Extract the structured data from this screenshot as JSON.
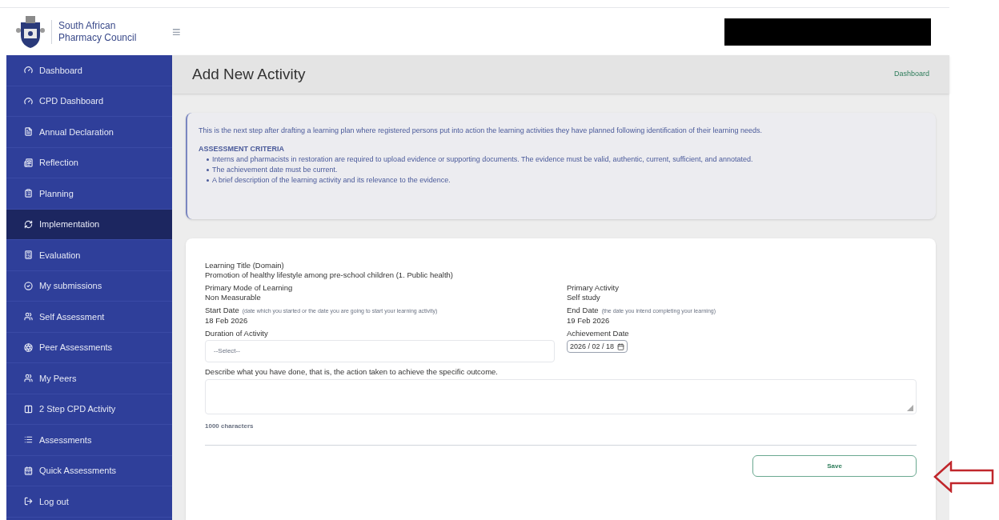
{
  "brand": {
    "line1": "South African",
    "line2": "Pharmacy Council"
  },
  "menu_icon": "≡",
  "sidebar": {
    "items": [
      {
        "label": "Dashboard",
        "selected": false
      },
      {
        "label": "CPD Dashboard",
        "selected": false
      },
      {
        "label": "Annual Declaration",
        "selected": false
      },
      {
        "label": "Reflection",
        "selected": false
      },
      {
        "label": "Planning",
        "selected": false
      },
      {
        "label": "Implementation",
        "selected": true
      },
      {
        "label": "Evaluation",
        "selected": false
      },
      {
        "label": "My submissions",
        "selected": false
      },
      {
        "label": "Self Assessment",
        "selected": false
      },
      {
        "label": "Peer Assessments",
        "selected": false
      },
      {
        "label": "My Peers",
        "selected": false
      },
      {
        "label": "2 Step CPD Activity",
        "selected": false
      },
      {
        "label": "Assessments",
        "selected": false
      },
      {
        "label": "Quick Assessments",
        "selected": false
      },
      {
        "label": "Log out",
        "selected": false
      }
    ]
  },
  "page": {
    "title": "Add New Activity",
    "breadcrumb": "Dashboard"
  },
  "info": {
    "intro": "This is the next step after drafting a learning plan where registered persons put into action the learning activities they have planned following identification of their learning needs.",
    "heading": "ASSESSMENT CRITERIA",
    "bullets": [
      "Interns and pharmacists in restoration are required to upload evidence or supporting documents. The evidence must be valid, authentic, current, sufficient, and annotated.",
      "The achievement date must be current.",
      "A brief description of the learning activity and its relevance to the evidence."
    ]
  },
  "form": {
    "learning_title": {
      "label": "Learning Title (Domain)",
      "value": "Promotion of healthy lifestyle among pre-school children (1. Public health)"
    },
    "primary_mode": {
      "label": "Primary Mode of Learning",
      "value": "Non Measurable"
    },
    "primary_activity": {
      "label": "Primary Activity",
      "value": "Self study"
    },
    "start_date": {
      "label": "Start Date",
      "note": "(date which you started or the date you are going to start your learning activity)",
      "value": "18 Feb 2026"
    },
    "end_date": {
      "label": "End Date",
      "note": "(the date you intend completing your learning)",
      "value": "19 Feb 2026"
    },
    "duration": {
      "label": "Duration of Activity",
      "placeholder": "--Select--"
    },
    "achievement_date": {
      "label": "Achievement Date",
      "value": "2026 / 02 / 18"
    },
    "description": {
      "label": "Describe what you have done, that is, the action taken to achieve the specific outcome."
    },
    "char_count": "1000 characters",
    "save": "Save"
  }
}
